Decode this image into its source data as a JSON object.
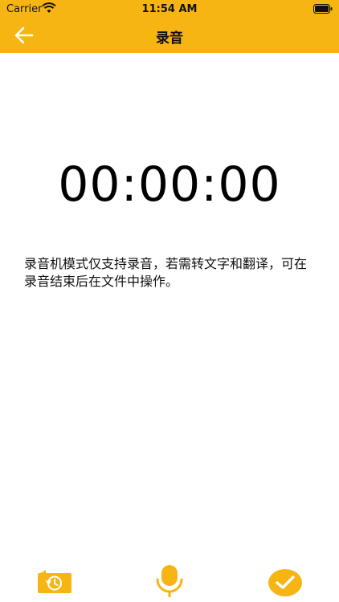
{
  "status_bar": {
    "carrier": "Carrier",
    "time": "11:54 AM"
  },
  "nav": {
    "title": "录音",
    "back_icon": "arrow-left-icon"
  },
  "timer": {
    "value": "00:00:00"
  },
  "notice": {
    "text": "录音机模式仅支持录音，若需转文字和翻译，可在录音结束后在文件中操作。"
  },
  "toolbar": {
    "history_icon": "history-icon",
    "mic_icon": "microphone-icon",
    "done_icon": "checkmark-icon"
  },
  "colors": {
    "accent": "#F7B514",
    "background": "#FFFFFF",
    "text": "#000000"
  }
}
